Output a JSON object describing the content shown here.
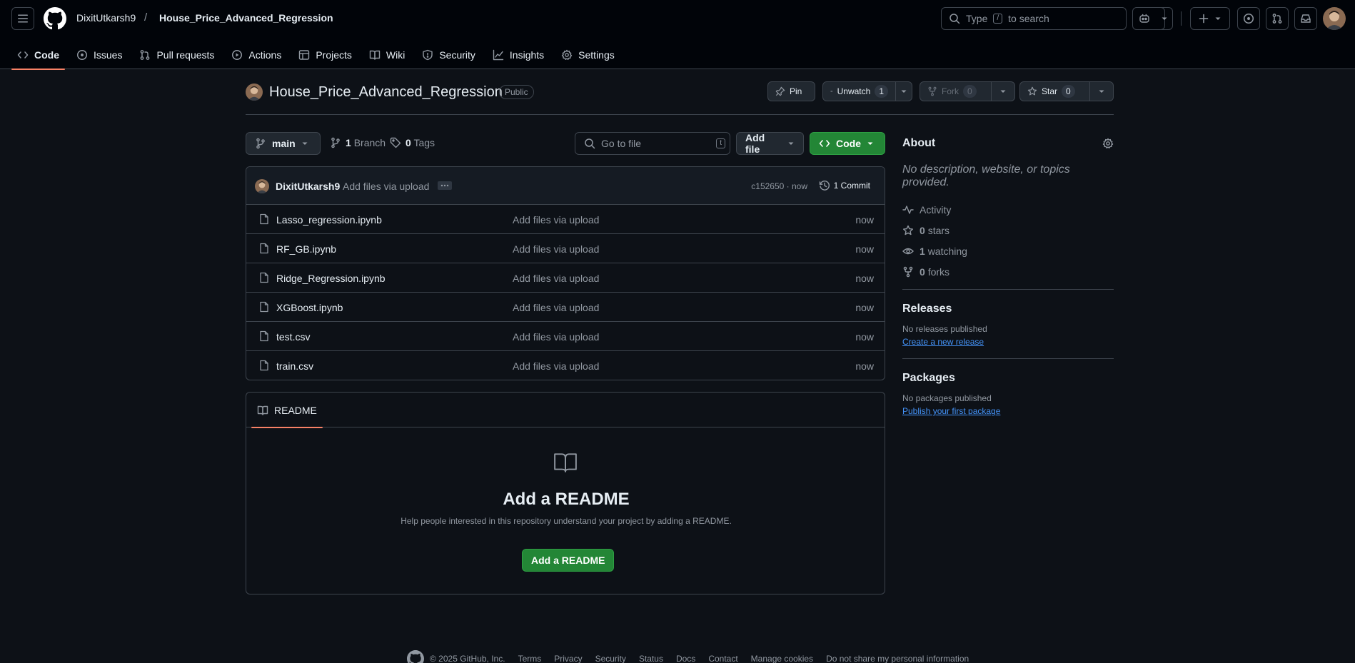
{
  "header": {
    "owner": "DixitUtkarsh9",
    "separator": "/",
    "repo": "House_Price_Advanced_Regression",
    "search_prefix": "Type",
    "search_key": "/",
    "search_suffix": "to search"
  },
  "tabs": [
    {
      "label": "Code",
      "icon": "code-icon",
      "active": true
    },
    {
      "label": "Issues",
      "icon": "issue-icon"
    },
    {
      "label": "Pull requests",
      "icon": "pull-request-icon"
    },
    {
      "label": "Actions",
      "icon": "play-icon"
    },
    {
      "label": "Projects",
      "icon": "table-icon"
    },
    {
      "label": "Wiki",
      "icon": "book-icon"
    },
    {
      "label": "Security",
      "icon": "shield-icon"
    },
    {
      "label": "Insights",
      "icon": "graph-icon"
    },
    {
      "label": "Settings",
      "icon": "gear-icon"
    }
  ],
  "repo_head": {
    "name": "House_Price_Advanced_Regression",
    "visibility": "Public",
    "pin_label": "Pin",
    "unwatch_label": "Unwatch",
    "watch_count": "1",
    "fork_label": "Fork",
    "fork_count": "0",
    "star_label": "Star",
    "star_count": "0"
  },
  "toolbar": {
    "branch": "main",
    "branch_count": "1",
    "branch_label": "Branch",
    "tag_count": "0",
    "tag_label": "Tags",
    "goto_placeholder": "Go to file",
    "goto_key": "t",
    "add_file_label": "Add file",
    "code_label": "Code"
  },
  "commit": {
    "author": "DixitUtkarsh9",
    "message": "Add files via upload",
    "hash_time": "c152650 · now",
    "count_label": "1 Commit"
  },
  "files": [
    {
      "name": "Lasso_regression.ipynb",
      "message": "Add files via upload",
      "time": "now"
    },
    {
      "name": "RF_GB.ipynb",
      "message": "Add files via upload",
      "time": "now"
    },
    {
      "name": "Ridge_Regression.ipynb",
      "message": "Add files via upload",
      "time": "now"
    },
    {
      "name": "XGBoost.ipynb",
      "message": "Add files via upload",
      "time": "now"
    },
    {
      "name": "test.csv",
      "message": "Add files via upload",
      "time": "now"
    },
    {
      "name": "train.csv",
      "message": "Add files via upload",
      "time": "now"
    }
  ],
  "readme": {
    "tab_label": "README",
    "title": "Add a README",
    "description": "Help people interested in this repository understand your project by adding a README.",
    "button_label": "Add a README"
  },
  "sidebar": {
    "about_title": "About",
    "about_desc": "No description, website, or topics provided.",
    "activity_label": "Activity",
    "stars_count": "0",
    "stars_label": "stars",
    "watching_count": "1",
    "watching_label": "watching",
    "forks_count": "0",
    "forks_label": "forks",
    "releases_title": "Releases",
    "releases_text": "No releases published",
    "releases_link": "Create a new release",
    "packages_title": "Packages",
    "packages_text": "No packages published",
    "packages_link": "Publish your first package"
  },
  "footer": {
    "copyright": "© 2025 GitHub, Inc.",
    "links": [
      "Terms",
      "Privacy",
      "Security",
      "Status",
      "Docs",
      "Contact",
      "Manage cookies",
      "Do not share my personal information"
    ]
  },
  "colors": {
    "background": "#0d1117",
    "header_bg": "#010409",
    "border": "#3d444d",
    "accent_green": "#238636",
    "tab_underline": "#f78166",
    "link": "#4493f8"
  }
}
